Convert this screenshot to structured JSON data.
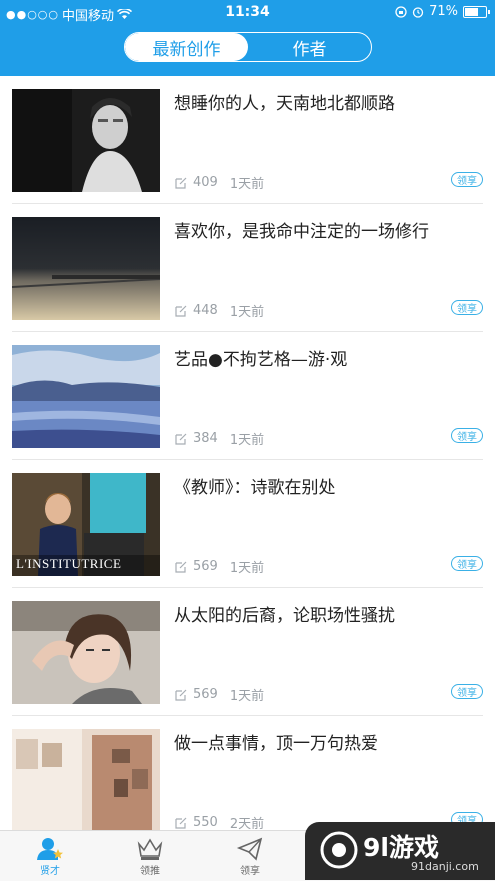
{
  "status_bar": {
    "carrier": "中国移动",
    "time": "11:34",
    "battery_percent": "71%",
    "battery_level": 0.71
  },
  "header": {
    "tabs": [
      {
        "label": "最新创作",
        "active": true
      },
      {
        "label": "作者",
        "active": false
      }
    ],
    "accent_color": "#1f9ee8"
  },
  "articles": [
    {
      "title": "想睡你的人，天南地北都顺路",
      "count": "409",
      "time": "1天前",
      "badge": "领享"
    },
    {
      "title": "喜欢你，是我命中注定的一场修行",
      "count": "448",
      "time": "1天前",
      "badge": "领享"
    },
    {
      "title": "艺品●不拘艺格—游·观",
      "count": "384",
      "time": "1天前",
      "badge": "领享"
    },
    {
      "title": "《教师》：诗歌在别处",
      "count": "569",
      "time": "1天前",
      "badge": "领享",
      "poster_text": "L'INSTITUTRICE"
    },
    {
      "title": "从太阳的后裔，论职场性骚扰",
      "count": "569",
      "time": "1天前",
      "badge": "领享"
    },
    {
      "title": "做一点事情，顶一万句热爱",
      "count": "550",
      "time": "2天前",
      "badge": "领享"
    }
  ],
  "tab_bar": {
    "items": [
      {
        "label": "贤才",
        "icon": "user-star-icon",
        "active": true
      },
      {
        "label": "领推",
        "icon": "crown-icon",
        "active": false
      },
      {
        "label": "领享",
        "icon": "paper-plane-icon",
        "active": false
      }
    ]
  },
  "watermark": {
    "main": "9l游戏",
    "sub": "91danji.com"
  }
}
